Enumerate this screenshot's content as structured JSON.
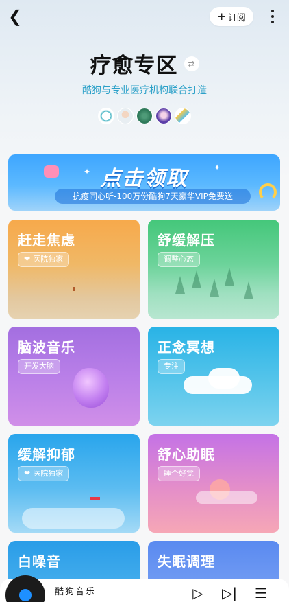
{
  "header": {
    "back_icon": "chevron-left-icon",
    "subscribe_label": "订阅",
    "more_icon": "more-vertical-icon"
  },
  "page": {
    "title": "疗愈专区",
    "swap_icon": "swap-icon",
    "subtitle": "酷狗与专业医疗机构联合打造",
    "partners": [
      {
        "name": "partner-logo-1",
        "color": "#ffffff"
      },
      {
        "name": "partner-logo-2",
        "color": "#e8eef2"
      },
      {
        "name": "partner-logo-3",
        "color": "#2f7a5a"
      },
      {
        "name": "partner-logo-4",
        "color": "#5b3ea8"
      },
      {
        "name": "partner-logo-5",
        "color": "#ffffff"
      }
    ]
  },
  "banner": {
    "title": "点击领取",
    "subtitle": "抗疫同心听-100万份酷狗7天豪华VIP免费送"
  },
  "cards": [
    {
      "title": "赶走焦虑",
      "tag": "医院独家",
      "heart": true
    },
    {
      "title": "舒缓解压",
      "tag": "调整心态",
      "heart": false
    },
    {
      "title": "脑波音乐",
      "tag": "开发大脑",
      "heart": false
    },
    {
      "title": "正念冥想",
      "tag": "专注",
      "heart": false
    },
    {
      "title": "缓解抑郁",
      "tag": "医院独家",
      "heart": true
    },
    {
      "title": "舒心助眠",
      "tag": "睡个好觉",
      "heart": false
    },
    {
      "title": "白噪音",
      "tag": "",
      "heart": false
    },
    {
      "title": "失眠调理",
      "tag": "",
      "heart": false
    }
  ],
  "player": {
    "song": "酷狗音乐",
    "play_icon": "play-icon",
    "next_icon": "next-icon",
    "playlist_icon": "playlist-icon"
  },
  "colors": {
    "accent_text": "#2aa0c8",
    "banner_blue": "#3ea6ff"
  }
}
